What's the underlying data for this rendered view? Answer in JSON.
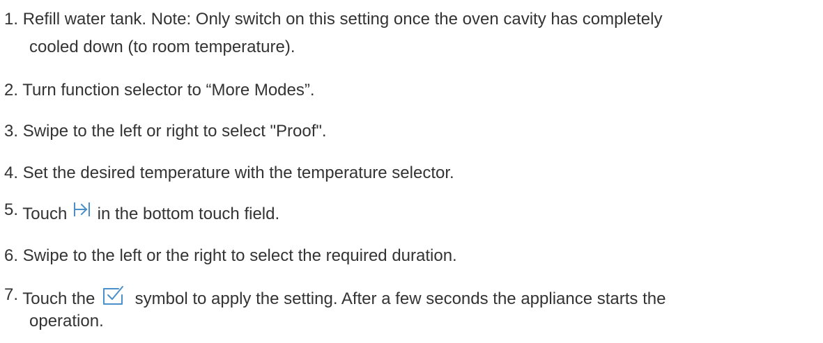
{
  "steps": [
    {
      "number": "1.",
      "text": "Refill water tank. Note: Only switch on this setting once the oven cavity has completely",
      "continuation": "cooled down (to room temperature)."
    },
    {
      "number": "2.",
      "text": "Turn function selector to “More Modes”."
    },
    {
      "number": "3.",
      "text": "Swipe to the left or right to select \"Proof\"."
    },
    {
      "number": "4.",
      "text": "Set the desired temperature with the temperature selector."
    },
    {
      "number": "5.",
      "text_before": "Touch",
      "icon": "skip-to-end-icon",
      "text_after": "in the bottom touch field."
    },
    {
      "number": "6.",
      "text": "Swipe to the left or the right to select the required duration."
    },
    {
      "number": "7.",
      "text_before": "Touch the",
      "icon": "checkbox-checked-icon",
      "text_after": "symbol to apply the setting. After a few seconds the appliance starts the",
      "continuation": "operation."
    }
  ],
  "icon_color": "#4a8fc9"
}
